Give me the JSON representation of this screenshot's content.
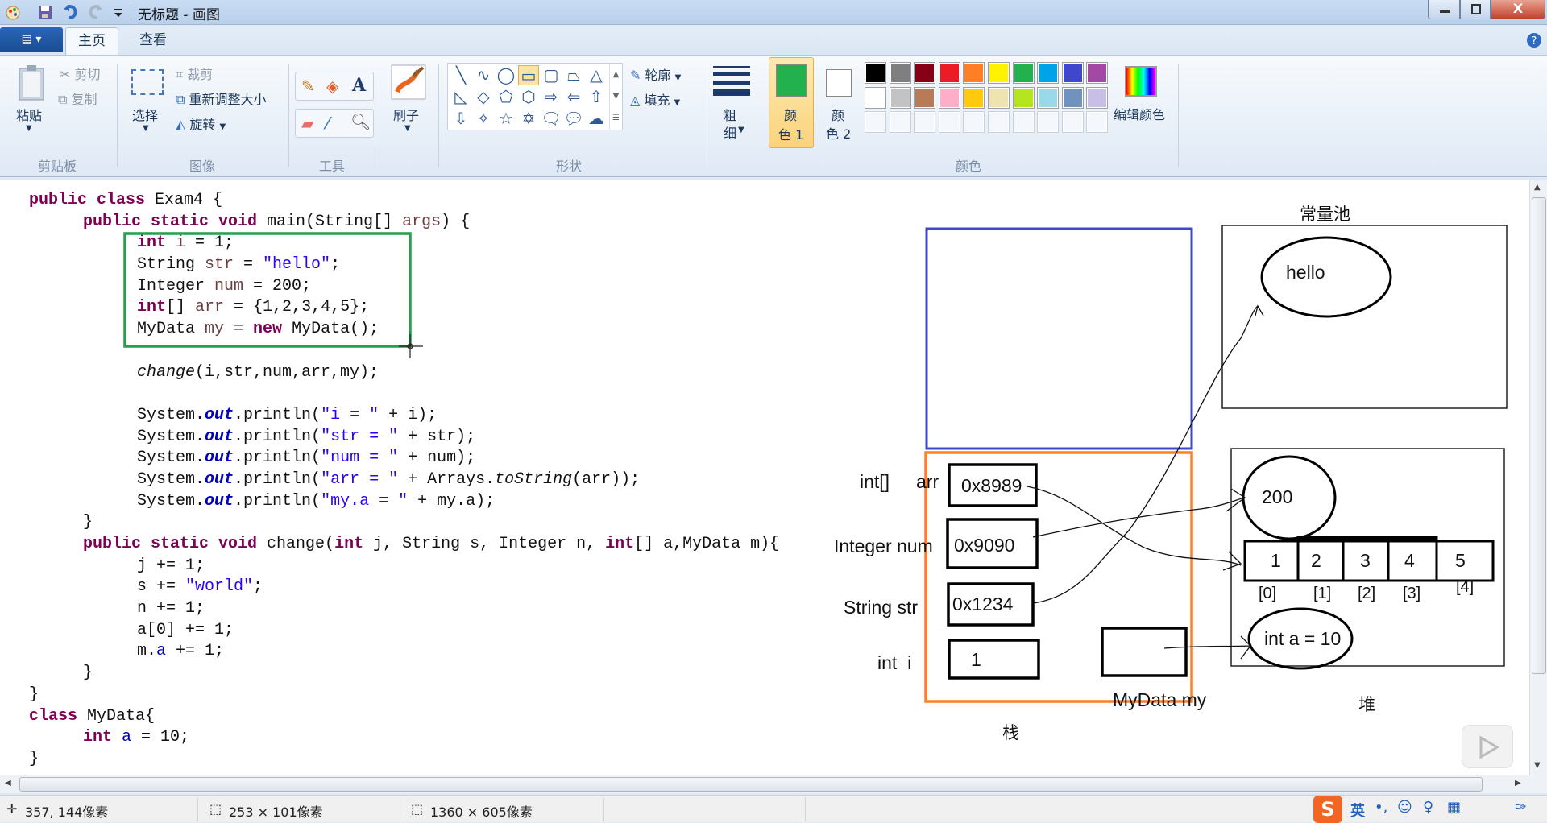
{
  "window": {
    "title": "无标题 - 画图"
  },
  "tabs": [
    {
      "label": "主页",
      "active": true
    },
    {
      "label": "查看",
      "active": false
    }
  ],
  "ribbon": {
    "clipboard": {
      "group": "剪贴板",
      "paste": "粘贴",
      "cut": "剪切",
      "copy": "复制"
    },
    "image": {
      "group": "图像",
      "select": "选择",
      "crop": "裁剪",
      "resize": "重新调整大小",
      "rotate": "旋转"
    },
    "tools": {
      "group": "工具"
    },
    "brush": {
      "label": "刷子"
    },
    "shapes": {
      "group": "形状",
      "outline": "轮廓",
      "fill": "填充",
      "selected": "rectangle"
    },
    "size": {
      "label_a": "粗",
      "label_b": "细"
    },
    "colors": {
      "group": "颜色",
      "color1_a": "颜",
      "color1_b": "色 1",
      "color2_a": "颜",
      "color2_b": "色 2",
      "color1": "#22b14c",
      "color2": "#ffffff",
      "edit": "编辑颜色",
      "palette_row1": [
        "#000000",
        "#7f7f7f",
        "#880015",
        "#ed1c24",
        "#ff7f27",
        "#fff200",
        "#22b14c",
        "#00a2e8",
        "#3f48cc",
        "#a349a4"
      ],
      "palette_row2": [
        "#ffffff",
        "#c3c3c3",
        "#b97a57",
        "#ffaec9",
        "#ffc90e",
        "#efe4b0",
        "#b5e61d",
        "#99d9ea",
        "#7092be",
        "#c8bfe7"
      ]
    }
  },
  "code": {
    "lines": [
      {
        "indent": 0,
        "t": [
          [
            "public class",
            "kw"
          ],
          [
            " Exam4 {",
            ""
          ]
        ]
      },
      {
        "indent": 1,
        "t": [
          [
            "public static void",
            "kw"
          ],
          [
            " main(String[] ",
            ""
          ],
          [
            "args",
            "var"
          ],
          [
            ") {",
            ""
          ]
        ]
      },
      {
        "indent": 2,
        "t": [
          [
            "int",
            "kw"
          ],
          [
            " ",
            ""
          ],
          [
            "i",
            "var"
          ],
          [
            " = 1;",
            ""
          ]
        ]
      },
      {
        "indent": 2,
        "t": [
          [
            "String ",
            ""
          ],
          [
            "str",
            "var"
          ],
          [
            " = ",
            ""
          ],
          [
            "\"hello\"",
            "str"
          ],
          [
            ";",
            ""
          ]
        ]
      },
      {
        "indent": 2,
        "t": [
          [
            "Integer ",
            ""
          ],
          [
            "num",
            "var"
          ],
          [
            " = 200;",
            ""
          ]
        ]
      },
      {
        "indent": 2,
        "t": [
          [
            "int",
            "kw"
          ],
          [
            "[] ",
            ""
          ],
          [
            "arr",
            "var"
          ],
          [
            " = {1,2,3,4,5};",
            ""
          ]
        ]
      },
      {
        "indent": 2,
        "t": [
          [
            "MyData ",
            ""
          ],
          [
            "my",
            "var"
          ],
          [
            " = ",
            ""
          ],
          [
            "new",
            "kw"
          ],
          [
            " MyData();",
            ""
          ]
        ]
      },
      {
        "indent": 0,
        "t": []
      },
      {
        "indent": 2,
        "t": [
          [
            "change",
            "it"
          ],
          [
            "(i,str,num,arr,my);",
            ""
          ]
        ]
      },
      {
        "indent": 0,
        "t": []
      },
      {
        "indent": 2,
        "t": [
          [
            "System.",
            ""
          ],
          [
            "out",
            "fld"
          ],
          [
            ".println(",
            ""
          ],
          [
            "\"i = \"",
            "str"
          ],
          [
            " + i);",
            ""
          ]
        ]
      },
      {
        "indent": 2,
        "t": [
          [
            "System.",
            ""
          ],
          [
            "out",
            "fld"
          ],
          [
            ".println(",
            ""
          ],
          [
            "\"str = \"",
            "str"
          ],
          [
            " + str);",
            ""
          ]
        ]
      },
      {
        "indent": 2,
        "t": [
          [
            "System.",
            ""
          ],
          [
            "out",
            "fld"
          ],
          [
            ".println(",
            ""
          ],
          [
            "\"num = \"",
            "str"
          ],
          [
            " + num);",
            ""
          ]
        ]
      },
      {
        "indent": 2,
        "t": [
          [
            "System.",
            ""
          ],
          [
            "out",
            "fld"
          ],
          [
            ".println(",
            ""
          ],
          [
            "\"arr = \"",
            "str"
          ],
          [
            " + Arrays.",
            ""
          ],
          [
            "toString",
            "it"
          ],
          [
            "(arr));",
            ""
          ]
        ]
      },
      {
        "indent": 2,
        "t": [
          [
            "System.",
            ""
          ],
          [
            "out",
            "fld"
          ],
          [
            ".println(",
            ""
          ],
          [
            "\"my.a = \"",
            "str"
          ],
          [
            " + my.a);",
            ""
          ]
        ]
      },
      {
        "indent": 1,
        "t": [
          [
            "}",
            ""
          ]
        ]
      },
      {
        "indent": 1,
        "t": [
          [
            "public static void",
            "kw"
          ],
          [
            " change(",
            ""
          ],
          [
            "int",
            "kw"
          ],
          [
            " j, String s, Integer n, ",
            ""
          ],
          [
            "int",
            "kw"
          ],
          [
            "[] a,MyData m){",
            ""
          ]
        ]
      },
      {
        "indent": 2,
        "t": [
          [
            "j += 1;",
            ""
          ]
        ]
      },
      {
        "indent": 2,
        "t": [
          [
            "s += ",
            ""
          ],
          [
            "\"world\"",
            "str"
          ],
          [
            ";",
            ""
          ]
        ]
      },
      {
        "indent": 2,
        "t": [
          [
            "n += 1;",
            ""
          ]
        ]
      },
      {
        "indent": 2,
        "t": [
          [
            "a[0] += 1;",
            ""
          ]
        ]
      },
      {
        "indent": 2,
        "t": [
          [
            "m.",
            ""
          ],
          [
            "a",
            "fld2"
          ],
          [
            " += 1;",
            ""
          ]
        ]
      },
      {
        "indent": 1,
        "t": [
          [
            "}",
            ""
          ]
        ]
      },
      {
        "indent": 0,
        "t": [
          [
            "}",
            ""
          ]
        ]
      },
      {
        "indent": 0,
        "t": [
          [
            "class",
            "kw"
          ],
          [
            " MyData{",
            ""
          ]
        ]
      },
      {
        "indent": 1,
        "t": [
          [
            "int",
            "kw"
          ],
          [
            " ",
            ""
          ],
          [
            "a",
            "fld2"
          ],
          [
            " = 10;",
            ""
          ]
        ]
      },
      {
        "indent": 0,
        "t": [
          [
            "}",
            ""
          ]
        ]
      }
    ]
  },
  "diagram": {
    "const_pool_label": "常量池",
    "hello": "hello",
    "stack_label": "栈",
    "heap_label": "堆",
    "labels": {
      "arr_type": "int[]",
      "arr_name": "arr",
      "num": "Integer num",
      "str": "String str",
      "i": "int  i",
      "my": "MyData my"
    },
    "stack_values": {
      "arr": "0x8989",
      "num": "0x9090",
      "str": "0x1234",
      "i": "1"
    },
    "heap": {
      "num": "200",
      "array": [
        "1",
        "2",
        "3",
        "4",
        "5"
      ],
      "indices": [
        "[0]",
        "[1]",
        "[2]",
        "[3]",
        "[4]"
      ],
      "field": "int a = 10"
    },
    "colors": {
      "selection": "#22b14c",
      "blue_box": "#3f48cc",
      "orange_box": "#ff7f27"
    }
  },
  "status": {
    "cursor": "357, 144像素",
    "selection": "253 × 101像素",
    "canvas": "1360 × 605像素",
    "ime": "英"
  }
}
